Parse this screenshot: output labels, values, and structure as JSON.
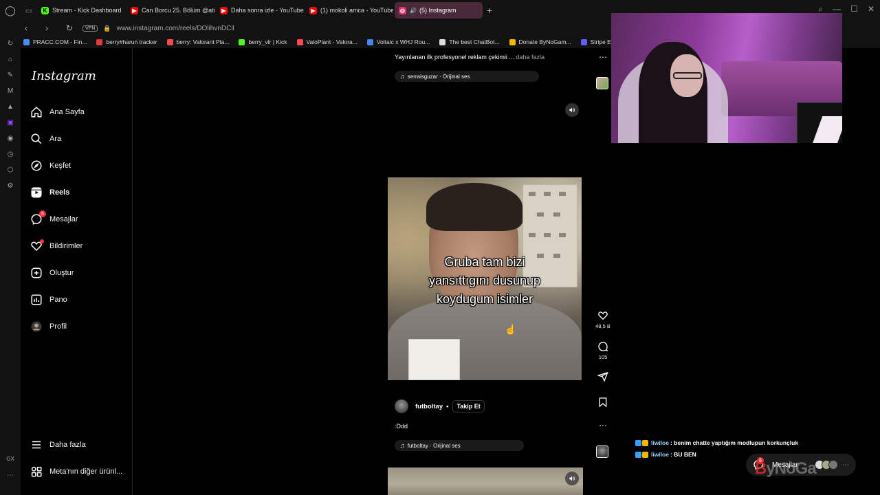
{
  "browser": {
    "tabs": [
      {
        "label": "Stream - Kick Dashboard",
        "icon": "kick-icon",
        "color": "#53fc18"
      },
      {
        "label": "Can Borcu 25. Bölüm @ati",
        "icon": "youtube-icon",
        "color": "#ff0000"
      },
      {
        "label": "Daha sonra izle - YouTube",
        "icon": "youtube-icon",
        "color": "#ff0000"
      },
      {
        "label": "(1) mokoli amca - YouTube",
        "icon": "youtube-icon",
        "color": "#ff0000"
      },
      {
        "label": "(5) Instagram",
        "icon": "instagram-icon",
        "color": "#e1306c",
        "active": true
      }
    ],
    "vpn_label": "VPN",
    "url": "www.instagram.com/reels/DOlihvnDCil",
    "bookmarks": [
      {
        "label": "PRACC.COM - Fin...",
        "color": "#4a8cff"
      },
      {
        "label": "berry#harun tracker",
        "color": "#e03a3a"
      },
      {
        "label": "berry: Valorant Pla...",
        "color": "#ff4655"
      },
      {
        "label": "berry_vlr | Kick",
        "color": "#53fc18"
      },
      {
        "label": "ValoPlant - Valora...",
        "color": "#ff4655"
      },
      {
        "label": "Voltaic x WHJ Rou...",
        "color": "#4285f4"
      },
      {
        "label": "The best ChatBot...",
        "color": "#dddddd"
      },
      {
        "label": "Donate ByNoGam...",
        "color": "#f2b800"
      },
      {
        "label": "Stripe Expr",
        "color": "#635bff"
      }
    ]
  },
  "instagram": {
    "logo": "Instagram",
    "nav": [
      {
        "label": "Ana Sayfa",
        "icon": "home-icon"
      },
      {
        "label": "Ara",
        "icon": "search-icon"
      },
      {
        "label": "Keşfet",
        "icon": "compass-icon"
      },
      {
        "label": "Reels",
        "icon": "reels-icon",
        "bold": true
      },
      {
        "label": "Mesajlar",
        "icon": "messenger-icon",
        "badge": "5"
      },
      {
        "label": "Bildirimler",
        "icon": "heart-icon",
        "dot": true
      },
      {
        "label": "Oluştur",
        "icon": "plus-square-icon"
      },
      {
        "label": "Pano",
        "icon": "dashboard-icon"
      },
      {
        "label": "Profil",
        "icon": "avatar"
      }
    ],
    "more_label": "Daha fazla",
    "meta_label": "Meta'nın diğer ürünl..."
  },
  "reel_prev": {
    "caption": "Yayınlanan ilk profesyonel reklam çekimii ...",
    "more": "daha fazla",
    "audio": "serraisguzar · Orijinal ses"
  },
  "reel": {
    "overlay_text_1": "Gruba tam bizi",
    "overlay_text_2": "yansıttıgını dusunup",
    "overlay_text_3": "koydugum isimler",
    "author": "futboltay",
    "separator": "•",
    "follow_label": "Takip Et",
    "caption": ":Ddd",
    "audio": "futboltay · Orijinal ses",
    "likes": "48,5 B",
    "comments": "105"
  },
  "stream_chat": [
    {
      "user": "liwiloe",
      "text": ": benim chatte yaptığım modlupun korkunçluk"
    },
    {
      "user": "liwiloe",
      "text": ": BU BEN"
    }
  ],
  "messages_pill": {
    "label": "Mesajlar",
    "badge": "5"
  },
  "watermark": {
    "part1": "B",
    "part2": "yNoGa"
  }
}
